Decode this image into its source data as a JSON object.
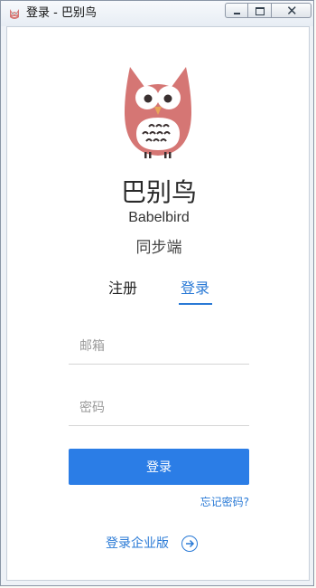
{
  "window": {
    "title": "登录 - 巴别鸟"
  },
  "brand": {
    "name_cn": "巴别鸟",
    "name_en": "Babelbird",
    "subtitle": "同步端",
    "logo": "owl-logo",
    "colors": {
      "owl_body": "#d57674",
      "owl_belly": "#ffffff",
      "owl_eye": "#333333",
      "owl_beak": "#e8a65a"
    }
  },
  "tabs": {
    "register_label": "注册",
    "login_label": "登录",
    "active": "login"
  },
  "form": {
    "email_placeholder": "邮箱",
    "email_value": "",
    "password_placeholder": "密码",
    "password_value": "",
    "submit_label": "登录",
    "forgot_label": "忘记密码?"
  },
  "footer": {
    "enterprise_label": "登录企业版",
    "enterprise_icon": "arrow-circle-right-icon"
  },
  "colors": {
    "accent": "#2a7ad6",
    "button": "#2b7de6"
  }
}
